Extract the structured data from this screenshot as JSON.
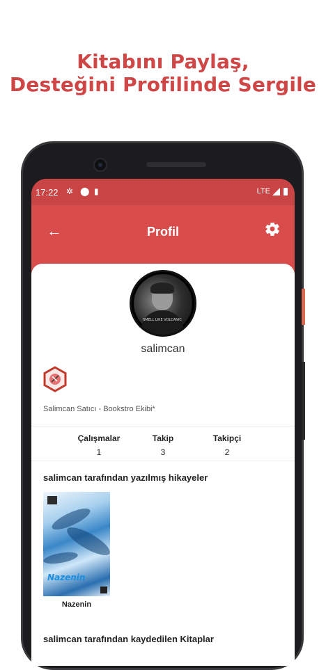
{
  "headline": {
    "line1": "Kitabını Paylaş,",
    "line2": "Desteğini Profilinde Sergile"
  },
  "status_bar": {
    "time": "17:22",
    "network": "LTE"
  },
  "app_bar": {
    "title": "Profil",
    "back_icon": "arrow-left-icon",
    "settings_icon": "gear-icon"
  },
  "profile": {
    "username": "salimcan",
    "avatar_shirt_text": "SMELL LIKE VOLCANIC",
    "bio": "Salimcan Satıcı - Bookstro Ekibi*",
    "badge_icon": "hexagon-badge-icon"
  },
  "stats": [
    {
      "label": "Çalışmalar",
      "value": "1"
    },
    {
      "label": "Takip",
      "value": "3"
    },
    {
      "label": "Takipçi",
      "value": "2"
    }
  ],
  "sections": {
    "written_title": "salimcan tarafından yazılmış hikayeler",
    "saved_title": "salimcan tarafından kaydedilen Kitaplar"
  },
  "books": [
    {
      "title": "Nazenin",
      "cover_title": "Nazenin"
    }
  ],
  "colors": {
    "accent": "#d94c4c",
    "headline": "#cf4646"
  }
}
